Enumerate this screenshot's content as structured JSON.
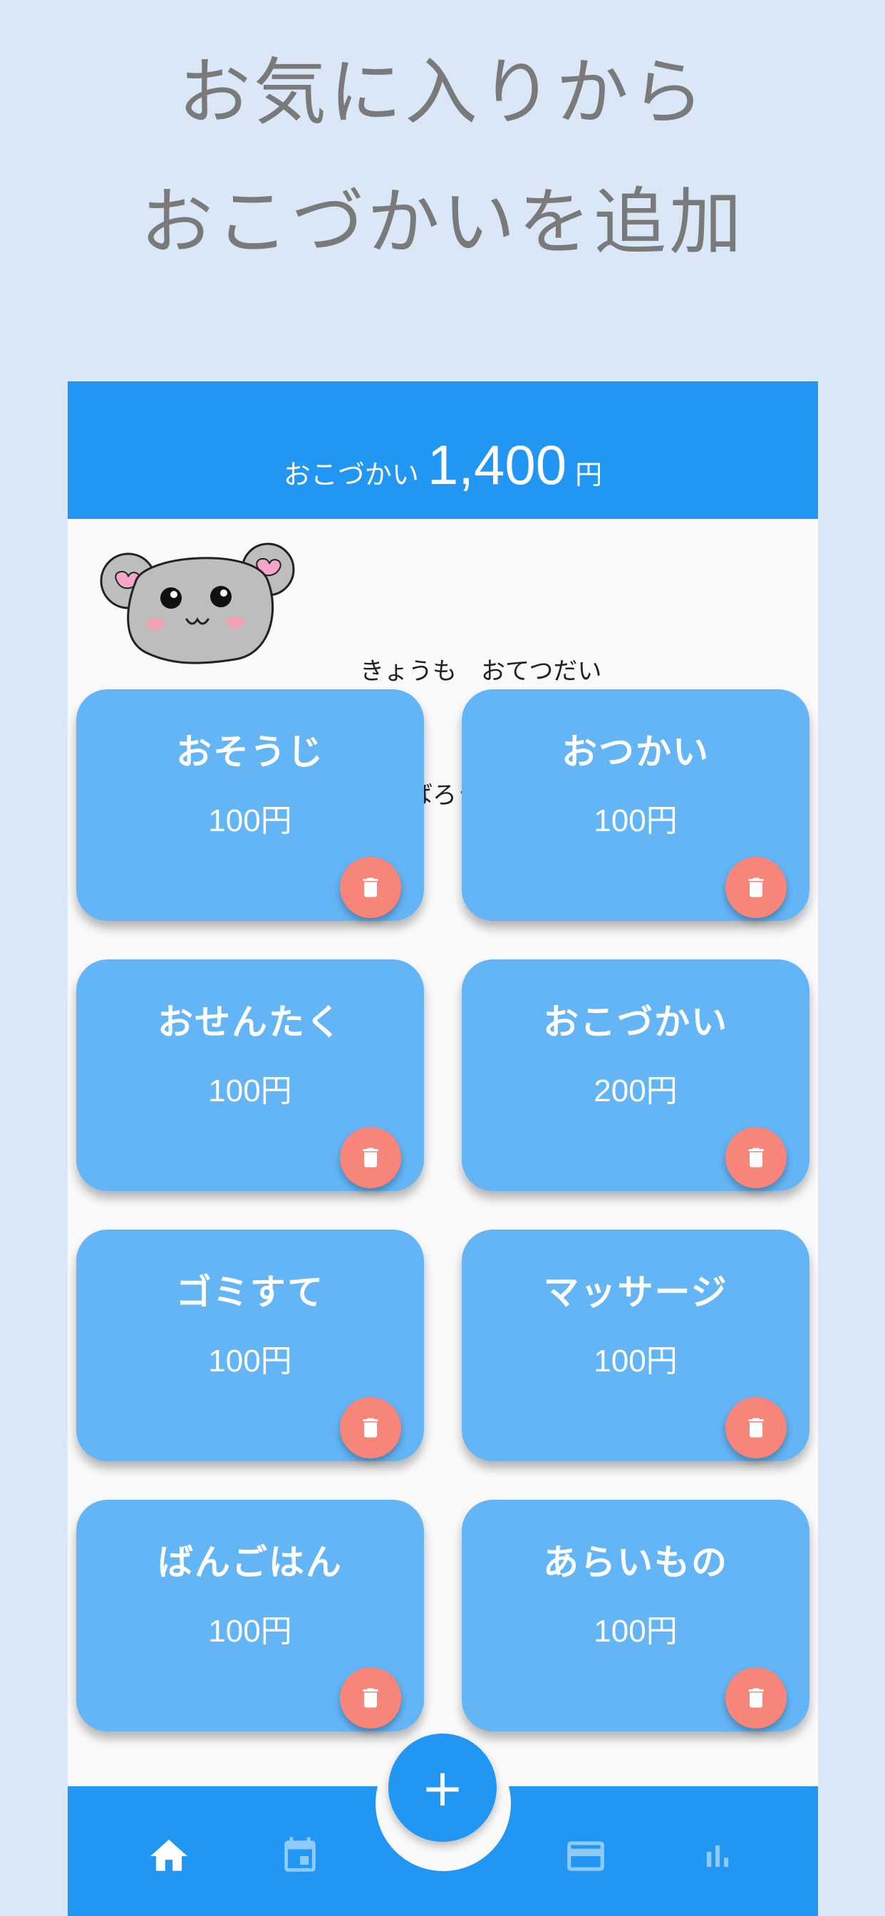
{
  "promo": {
    "line1": "お気に入りから",
    "line2": "おこづかいを追加"
  },
  "header": {
    "balance_label": "おこづかい",
    "balance_amount": "1,400",
    "balance_unit": "円"
  },
  "mascot": {
    "message_line1": "きょうも　おてつだい",
    "message_line2": "がんばろうね！"
  },
  "favorites": [
    {
      "title": "おそうじ",
      "price": "100円"
    },
    {
      "title": "おつかい",
      "price": "100円"
    },
    {
      "title": "おせんたく",
      "price": "100円"
    },
    {
      "title": "おこづかい",
      "price": "200円"
    },
    {
      "title": "ゴミすて",
      "price": "100円"
    },
    {
      "title": "マッサージ",
      "price": "100円"
    },
    {
      "title": "ばんごはん",
      "price": "100円"
    },
    {
      "title": "あらいもの",
      "price": "100円"
    }
  ],
  "fab": {
    "label": "+"
  },
  "colors": {
    "background": "#d9e7f7",
    "primary": "#2196f3",
    "card": "#64b5f6",
    "delete": "#f7857a",
    "promo_text": "#7a7a7a"
  },
  "icons": {
    "nav": [
      "home-icon",
      "calendar-icon",
      "card-icon",
      "bar-chart-icon"
    ],
    "delete": "trash-icon",
    "mascot": "hamster-face"
  }
}
